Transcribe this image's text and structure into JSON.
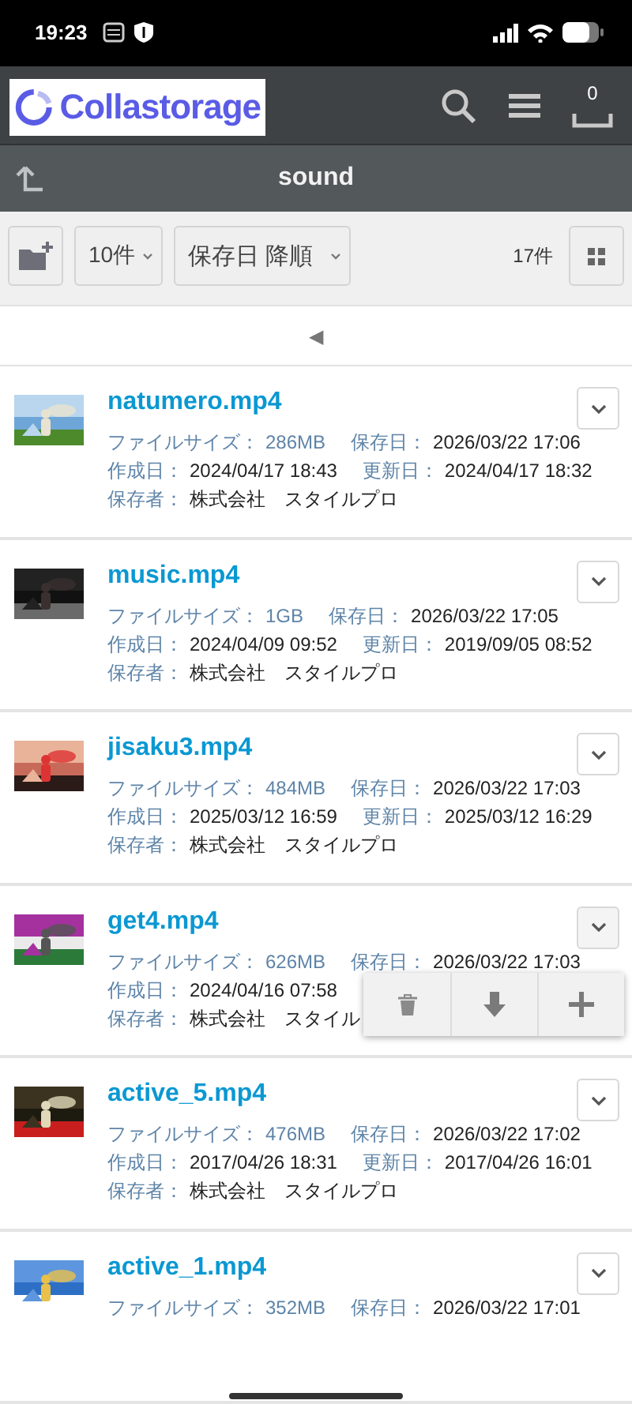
{
  "status_bar": {
    "time": "19:23"
  },
  "header": {
    "logo_text": "Collastorage",
    "cart_count": "0"
  },
  "path_bar": {
    "title": "sound"
  },
  "toolbar": {
    "per_page": "10件",
    "sort": "保存日 降順",
    "count": "17件"
  },
  "pager": {
    "prev": "◀"
  },
  "files": [
    {
      "name": "natumero.mp4",
      "menu_open": false,
      "lines": [
        [
          {
            "label": "ファイルサイズ：",
            "value": "286MB",
            "kind": "size"
          },
          {
            "label": "保存日：",
            "value": "2026/03/22 17:06",
            "kind": "plain"
          }
        ],
        [
          {
            "label": "作成日：",
            "value": "2024/04/17 18:43",
            "kind": "plain"
          },
          {
            "label": "更新日：",
            "value": "2024/04/17 18:32",
            "kind": "plain"
          }
        ],
        [
          {
            "label": "保存者：",
            "value": "株式会社　スタイルプロ",
            "kind": "plain"
          }
        ]
      ]
    },
    {
      "name": "music.mp4",
      "menu_open": false,
      "lines": [
        [
          {
            "label": "ファイルサイズ：",
            "value": "1GB",
            "kind": "size"
          },
          {
            "label": "保存日：",
            "value": "2026/03/22 17:05",
            "kind": "plain"
          }
        ],
        [
          {
            "label": "作成日：",
            "value": "2024/04/09 09:52",
            "kind": "plain"
          },
          {
            "label": "更新日：",
            "value": "2019/09/05 08:52",
            "kind": "plain"
          }
        ],
        [
          {
            "label": "保存者：",
            "value": "株式会社　スタイルプロ",
            "kind": "plain"
          }
        ]
      ]
    },
    {
      "name": "jisaku3.mp4",
      "menu_open": false,
      "lines": [
        [
          {
            "label": "ファイルサイズ：",
            "value": "484MB",
            "kind": "size"
          },
          {
            "label": "保存日：",
            "value": "2026/03/22 17:03",
            "kind": "plain"
          }
        ],
        [
          {
            "label": "作成日：",
            "value": "2025/03/12 16:59",
            "kind": "plain"
          },
          {
            "label": "更新日：",
            "value": "2025/03/12 16:29",
            "kind": "plain"
          }
        ],
        [
          {
            "label": "保存者：",
            "value": "株式会社　スタイルプロ",
            "kind": "plain"
          }
        ]
      ]
    },
    {
      "name": "get4.mp4",
      "menu_open": true,
      "lines": [
        [
          {
            "label": "ファイルサイズ：",
            "value": "626MB",
            "kind": "size"
          },
          {
            "label": "保存日：",
            "value": "2026/03/22 17:03",
            "kind": "plain"
          }
        ],
        [
          {
            "label": "作成日：",
            "value": "2024/04/16 07:58",
            "kind": "plain"
          }
        ],
        [
          {
            "label": "保存者：",
            "value": "株式会社　スタイル",
            "kind": "plain"
          }
        ]
      ]
    },
    {
      "name": "active_5.mp4",
      "menu_open": false,
      "lines": [
        [
          {
            "label": "ファイルサイズ：",
            "value": "476MB",
            "kind": "size"
          },
          {
            "label": "保存日：",
            "value": "2026/03/22 17:02",
            "kind": "plain"
          }
        ],
        [
          {
            "label": "作成日：",
            "value": "2017/04/26 18:31",
            "kind": "plain"
          },
          {
            "label": "更新日：",
            "value": "2017/04/26 16:01",
            "kind": "plain"
          }
        ],
        [
          {
            "label": "保存者：",
            "value": "株式会社　スタイルプロ",
            "kind": "plain"
          }
        ]
      ]
    },
    {
      "name": "active_1.mp4",
      "menu_open": false,
      "lines": [
        [
          {
            "label": "ファイルサイズ：",
            "value": "352MB",
            "kind": "size"
          },
          {
            "label": "保存日：",
            "value": "2026/03/22 17:01",
            "kind": "plain"
          }
        ]
      ]
    }
  ]
}
